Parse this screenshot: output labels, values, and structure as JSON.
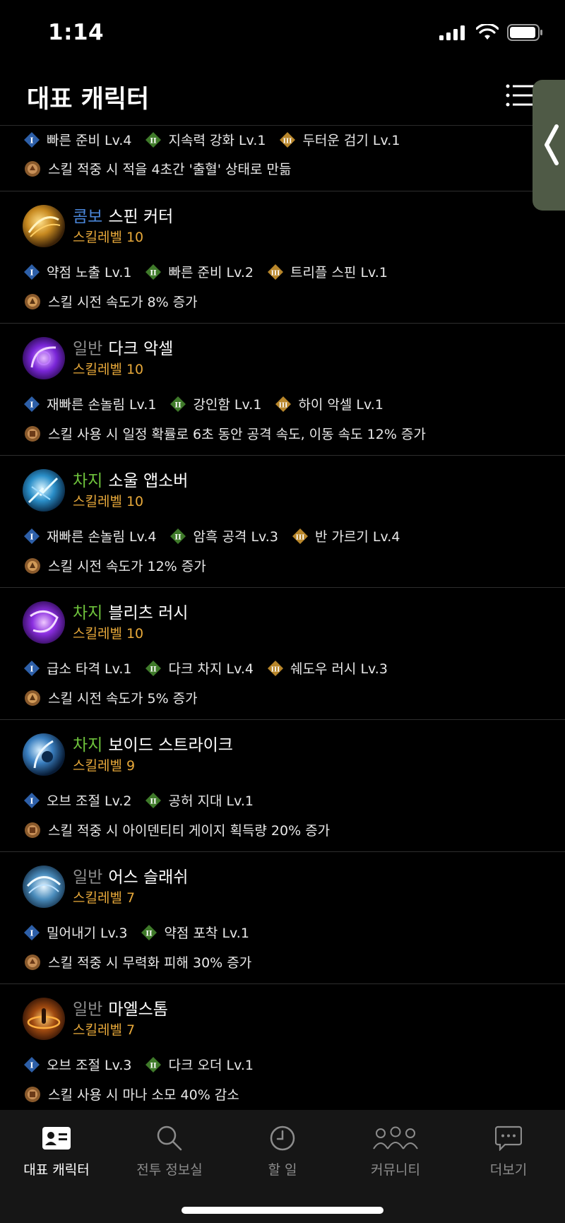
{
  "status": {
    "time": "1:14"
  },
  "header": {
    "title": "대표 캐릭터"
  },
  "top_partial": {
    "tripods": [
      {
        "tier": "I",
        "label": "빠른 준비 Lv.4"
      },
      {
        "tier": "II",
        "label": "지속력 강화 Lv.1"
      },
      {
        "tier": "III",
        "label": "두터운 검기 Lv.1"
      }
    ],
    "rune": "스킬 적중 시 적을 4초간 '출혈' 상태로 만듦"
  },
  "skills": [
    {
      "type": "콤보",
      "type_color": "#4a86d9",
      "name": "스핀 커터",
      "level": "스킬레벨 10",
      "tripods": [
        {
          "tier": "I",
          "label": "약점 노출 Lv.1"
        },
        {
          "tier": "II",
          "label": "빠른 준비 Lv.2"
        },
        {
          "tier": "III",
          "label": "트리플 스핀 Lv.1"
        }
      ],
      "rune": "스킬 시전 속도가 8% 증가"
    },
    {
      "type": "일반",
      "type_color": "#8d8d8d",
      "name": "다크 악셀",
      "level": "스킬레벨 10",
      "tripods": [
        {
          "tier": "I",
          "label": "재빠른 손놀림 Lv.1"
        },
        {
          "tier": "II",
          "label": "강인함 Lv.1"
        },
        {
          "tier": "III",
          "label": "하이 악셀 Lv.1"
        }
      ],
      "rune": "스킬 사용 시 일정 확률로 6초 동안 공격 속도, 이동 속도 12% 증가"
    },
    {
      "type": "차지",
      "type_color": "#6ec23c",
      "name": "소울 앱소버",
      "level": "스킬레벨 10",
      "tripods": [
        {
          "tier": "I",
          "label": "재빠른 손놀림 Lv.4"
        },
        {
          "tier": "II",
          "label": "암흑 공격 Lv.3"
        },
        {
          "tier": "III",
          "label": "반 가르기 Lv.4"
        }
      ],
      "rune": "스킬 시전 속도가 12% 증가"
    },
    {
      "type": "차지",
      "type_color": "#6ec23c",
      "name": "블리츠 러시",
      "level": "스킬레벨 10",
      "tripods": [
        {
          "tier": "I",
          "label": "급소 타격 Lv.1"
        },
        {
          "tier": "II",
          "label": "다크 차지 Lv.4"
        },
        {
          "tier": "III",
          "label": "쉐도우 러시 Lv.3"
        }
      ],
      "rune": "스킬 시전 속도가 5% 증가"
    },
    {
      "type": "차지",
      "type_color": "#6ec23c",
      "name": "보이드 스트라이크",
      "level": "스킬레벨 9",
      "tripods": [
        {
          "tier": "I",
          "label": "오브 조절 Lv.2"
        },
        {
          "tier": "II",
          "label": "공허 지대 Lv.1"
        }
      ],
      "rune": "스킬 적중 시 아이덴티티 게이지 획득량 20% 증가"
    },
    {
      "type": "일반",
      "type_color": "#8d8d8d",
      "name": "어스 슬래쉬",
      "level": "스킬레벨 7",
      "tripods": [
        {
          "tier": "I",
          "label": "밀어내기 Lv.3"
        },
        {
          "tier": "II",
          "label": "약점 포착 Lv.1"
        }
      ],
      "rune": "스킬 적중 시 무력화 피해 30% 증가"
    },
    {
      "type": "일반",
      "type_color": "#8d8d8d",
      "name": "마엘스톰",
      "level": "스킬레벨 7",
      "tripods": [
        {
          "tier": "I",
          "label": "오브 조절 Lv.3"
        },
        {
          "tier": "II",
          "label": "다크 오더 Lv.1"
        }
      ],
      "rune": "스킬 사용 시 마나 소모 40% 감소"
    }
  ],
  "tabs": [
    {
      "label": "대표 캐릭터",
      "icon": "id-card-icon"
    },
    {
      "label": "전투 정보실",
      "icon": "search-icon"
    },
    {
      "label": "할 일",
      "icon": "clock-icon"
    },
    {
      "label": "커뮤니티",
      "icon": "community-icon"
    },
    {
      "label": "더보기",
      "icon": "chat-bubble-icon"
    }
  ]
}
